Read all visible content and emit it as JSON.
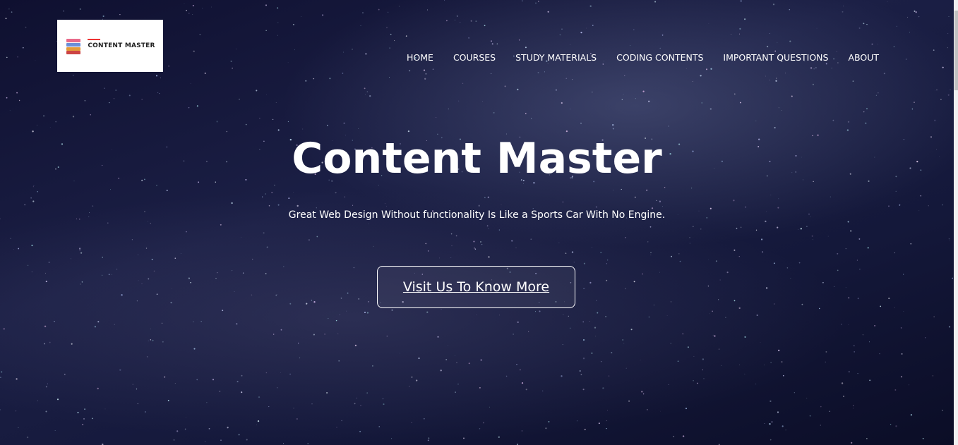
{
  "logo": {
    "text": "CONTENT MASTER"
  },
  "nav": {
    "items": [
      "HOME",
      "COURSES",
      "STUDY MATERIALS",
      "CODING CONTENTS",
      "IMPORTANT QUESTIONS",
      "ABOUT"
    ]
  },
  "hero": {
    "title": "Content Master",
    "subtitle": "Great Web Design Without functionality Is Like a Sports Car With No Engine.",
    "button": "Visit Us To Know More"
  },
  "colors": {
    "background": "#14183a",
    "text": "#ffffff",
    "logo_accent": "#e33333"
  }
}
